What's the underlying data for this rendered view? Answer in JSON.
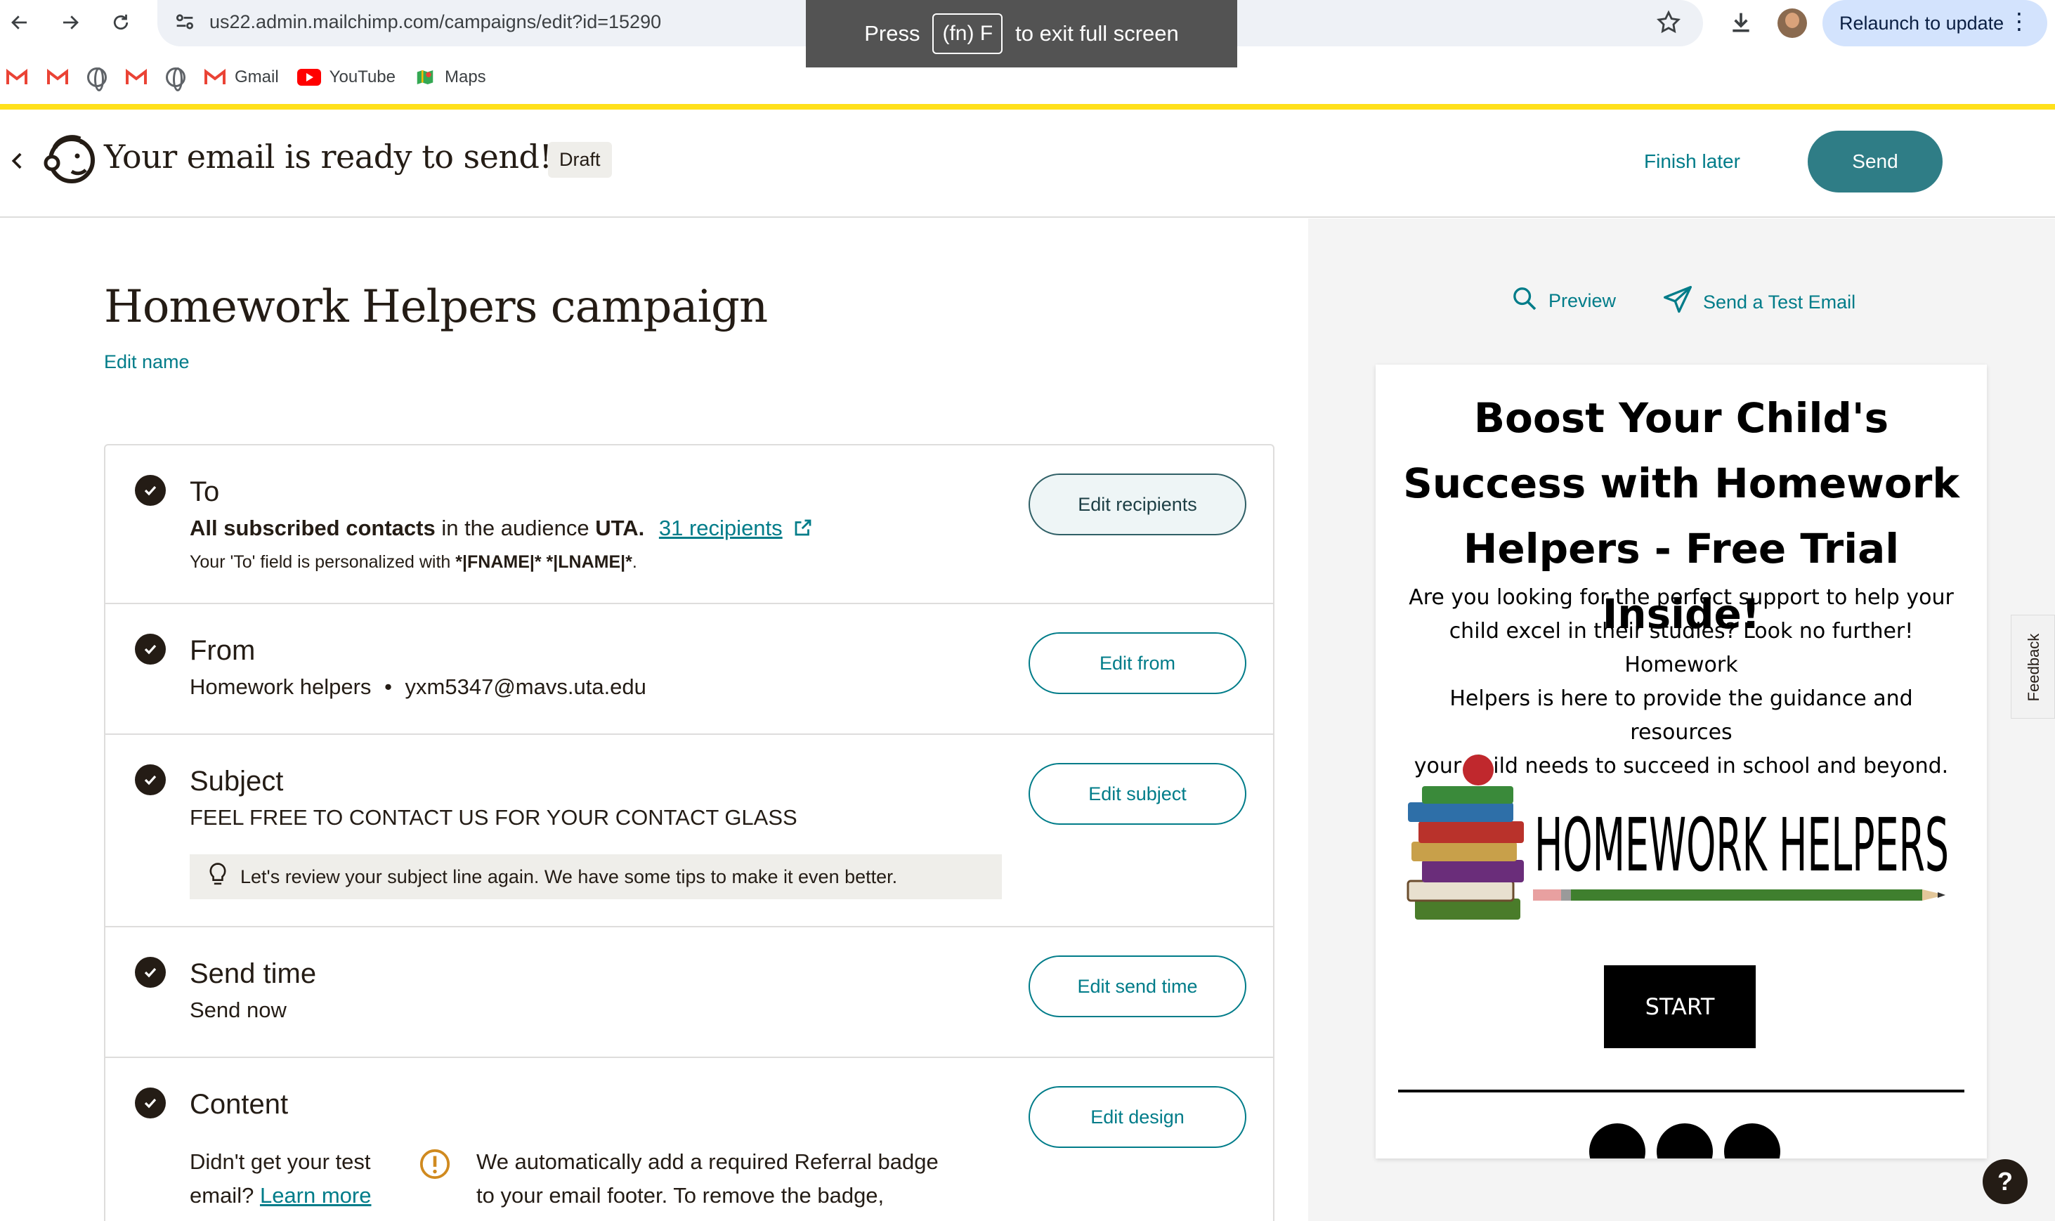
{
  "browser": {
    "url": "us22.admin.mailchimp.com/campaigns/edit?id=15290",
    "fullscreen_toast": {
      "prefix": "Press",
      "key": "(fn) F",
      "suffix": "to exit full screen"
    },
    "relaunch_label": "Relaunch to update",
    "bookmarks": [
      {
        "label": "",
        "icon": "gmail-icon"
      },
      {
        "label": "",
        "icon": "gmail-icon"
      },
      {
        "label": "",
        "icon": "globe-icon"
      },
      {
        "label": "",
        "icon": "gmail-icon"
      },
      {
        "label": "",
        "icon": "globe-icon"
      },
      {
        "label": "Gmail",
        "icon": "gmail-icon"
      },
      {
        "label": "YouTube",
        "icon": "youtube-icon"
      },
      {
        "label": "Maps",
        "icon": "maps-icon"
      }
    ]
  },
  "header": {
    "title": "Your email is ready to send!",
    "badge": "Draft",
    "finish_later": "Finish later",
    "send": "Send"
  },
  "campaign": {
    "name": "Homework Helpers campaign",
    "edit_name": "Edit name"
  },
  "checklist": {
    "to": {
      "title": "To",
      "line_bold1": "All subscribed contacts",
      "line_mid": " in the audience ",
      "line_bold2": "UTA.",
      "recipients_link": "31 recipients",
      "note_prefix": "Your 'To' field is personalized with ",
      "note_tags": "*|FNAME|* *|LNAME|*",
      "note_suffix": ".",
      "button": "Edit recipients"
    },
    "from": {
      "title": "From",
      "name": "Homework helpers",
      "separator": "•",
      "email": "yxm5347@mavs.uta.edu",
      "button": "Edit from"
    },
    "subject": {
      "title": "Subject",
      "value": "FEEL FREE TO CONTACT US FOR YOUR CONTACT GLASS",
      "tip": "Let's review your subject line again. We have some tips to make it even better.",
      "button": "Edit subject"
    },
    "send_time": {
      "title": "Send time",
      "value": "Send now",
      "button": "Edit send time"
    },
    "content": {
      "title": "Content",
      "test_line1": "Didn't get your test",
      "test_line2": "email?",
      "learn_more": "Learn more",
      "notice_line1": "We automatically add a required Referral badge",
      "notice_line2": "to your email footer. To remove the badge,",
      "button": "Edit design"
    }
  },
  "preview": {
    "preview_label": "Preview",
    "test_email_label": "Send a Test Email",
    "headline_lines": [
      "Boost Your Child's",
      "Success with Homework",
      "Helpers - Free Trial Inside!"
    ],
    "body_lines": [
      "Are you looking for the perfect support to help your",
      "child excel in their studies? Look no further! Homework",
      "Helpers is here to provide the guidance and resources",
      "your child needs to succeed in school and beyond."
    ],
    "logo_text": "HOMEWORK HELPERS",
    "start_button": "START"
  },
  "feedback_tab": "Feedback",
  "help": "?",
  "colors": {
    "accent_teal": "#007c89",
    "send_button": "#2f7d86",
    "brand_yellow": "#ffe01b",
    "ink": "#241c15"
  }
}
